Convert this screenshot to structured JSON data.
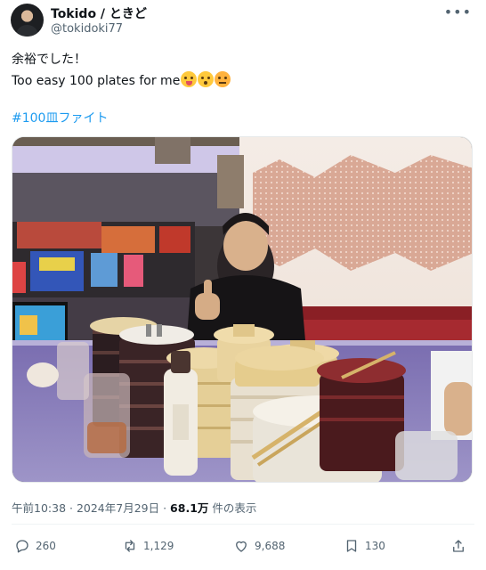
{
  "author": {
    "name": "Tokido / ときど",
    "handle": "@tokidoki77"
  },
  "tweet": {
    "line1": "余裕でした！",
    "line2": "Too easy 100 plates for me",
    "hashtag": "#100皿ファイト",
    "photo_icon": "photo-sushi-plates"
  },
  "meta": {
    "time_date": "午前10:38 · 2024年7月29日 · ",
    "views_count": "68.1万",
    "views_label": " 件の表示"
  },
  "actions": {
    "replies": "260",
    "retweets": "1,129",
    "likes": "9,688",
    "bookmarks": "130"
  },
  "colors": {
    "accent": "#1d9bf0",
    "secondary_text": "#536471"
  }
}
